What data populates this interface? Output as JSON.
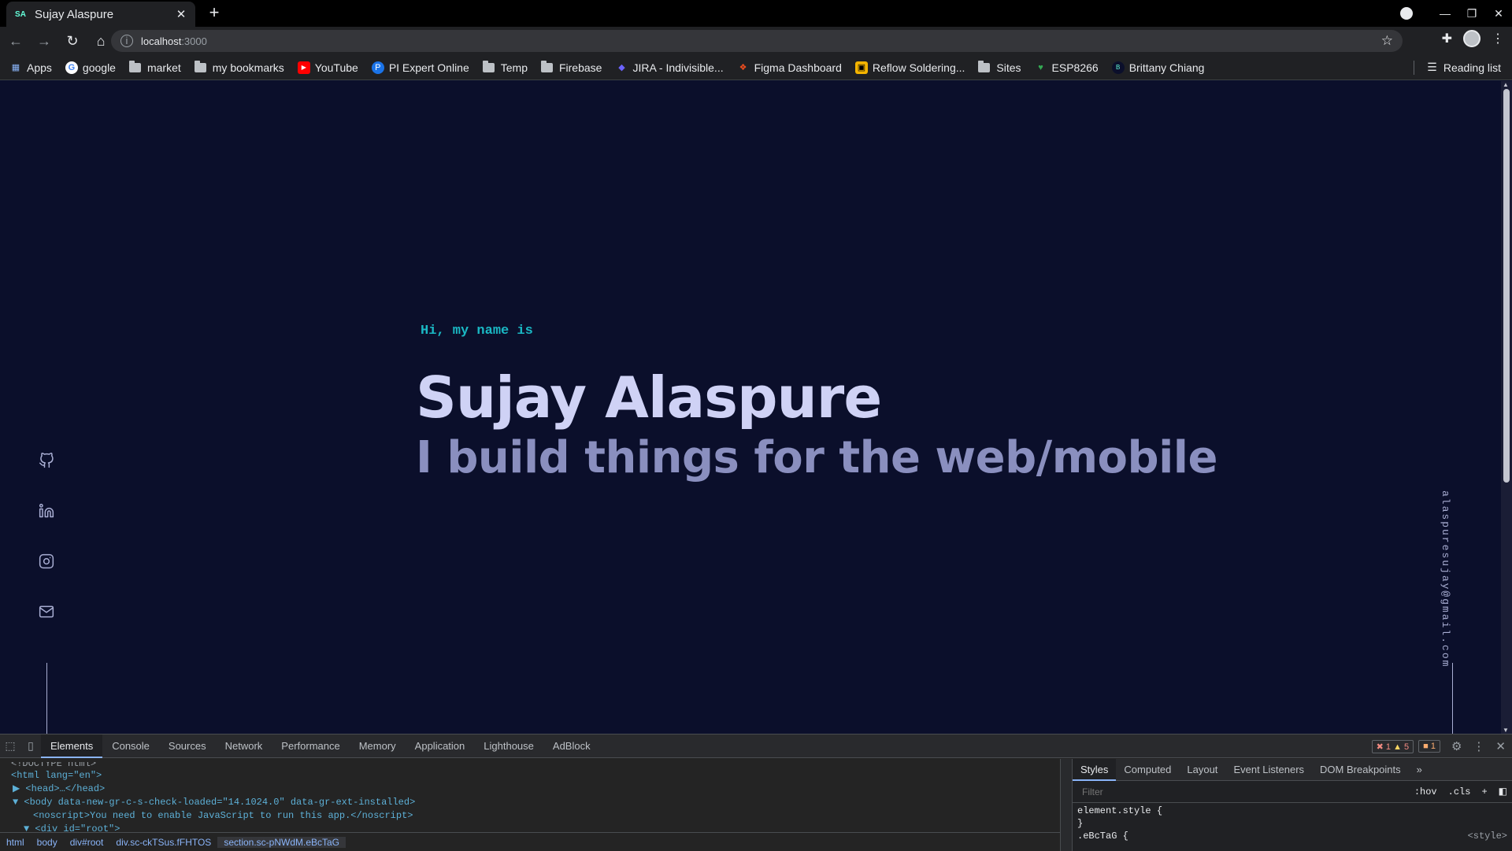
{
  "browser": {
    "tab_title": "Sujay Alaspure",
    "tab_favicon": "SA",
    "url_host": "localhost",
    "url_port": ":3000",
    "bookmarks": [
      {
        "label": "Apps",
        "icon": "apps-grid-icon"
      },
      {
        "label": "google",
        "icon": "google-icon"
      },
      {
        "label": "market",
        "icon": "folder-icon"
      },
      {
        "label": "my bookmarks",
        "icon": "folder-icon"
      },
      {
        "label": "YouTube",
        "icon": "youtube-icon"
      },
      {
        "label": "PI Expert Online",
        "icon": "pi-icon"
      },
      {
        "label": "Temp",
        "icon": "folder-icon"
      },
      {
        "label": "Firebase",
        "icon": "folder-icon"
      },
      {
        "label": "JIRA - Indivisible...",
        "icon": "jira-icon"
      },
      {
        "label": "Figma Dashboard",
        "icon": "figma-icon"
      },
      {
        "label": "Reflow Soldering...",
        "icon": "site-icon"
      },
      {
        "label": "Sites",
        "icon": "folder-icon"
      },
      {
        "label": "ESP8266",
        "icon": "esp-icon"
      },
      {
        "label": "Brittany Chiang",
        "icon": "site-icon"
      }
    ],
    "reading_list": "Reading list"
  },
  "hero": {
    "greeting": "Hi, my name is",
    "name": "Sujay Alaspure",
    "tagline": "I build things for the web/mobile"
  },
  "side": {
    "email": "alaspuresujay@gmail.com",
    "social": [
      "github-icon",
      "linkedin-icon",
      "instagram-icon",
      "mail-icon"
    ]
  },
  "devtools": {
    "tabs": [
      "Elements",
      "Console",
      "Sources",
      "Network",
      "Performance",
      "Memory",
      "Application",
      "Lighthouse",
      "AdBlock"
    ],
    "badges": {
      "errors": "1",
      "warnings": "5",
      "info": "1"
    },
    "dom_lines": [
      {
        "text": "<!DOCTYPE html>"
      },
      {
        "text": "<html lang=\"en\">"
      },
      {
        "text": "▶ <head>…</head>"
      },
      {
        "text": "▼ <body data-new-gr-c-s-check-loaded=\"14.1024.0\" data-gr-ext-installed>"
      },
      {
        "text": "<noscript>You need to enable JavaScript to run this app.</noscript>"
      },
      {
        "text": "▼ <div id=\"root\">"
      }
    ],
    "breadcrumbs": [
      "html",
      "body",
      "div#root",
      "div.sc-ckTSus.fFHTOS",
      "section.sc-pNWdM.eBcTaG"
    ],
    "styles_tabs": [
      "Styles",
      "Computed",
      "Layout",
      "Event Listeners",
      "DOM Breakpoints"
    ],
    "filter_placeholder": "Filter",
    "hov": ":hov",
    "cls": ".cls",
    "rules": [
      "element.style {",
      "}",
      ".eBcTaG {"
    ],
    "rule_source": "<style>"
  },
  "colors": {
    "background": "#0b0f2b",
    "accent": "#1ab8c4",
    "name": "#cfd2f5",
    "tagline": "#8a8fbf"
  }
}
